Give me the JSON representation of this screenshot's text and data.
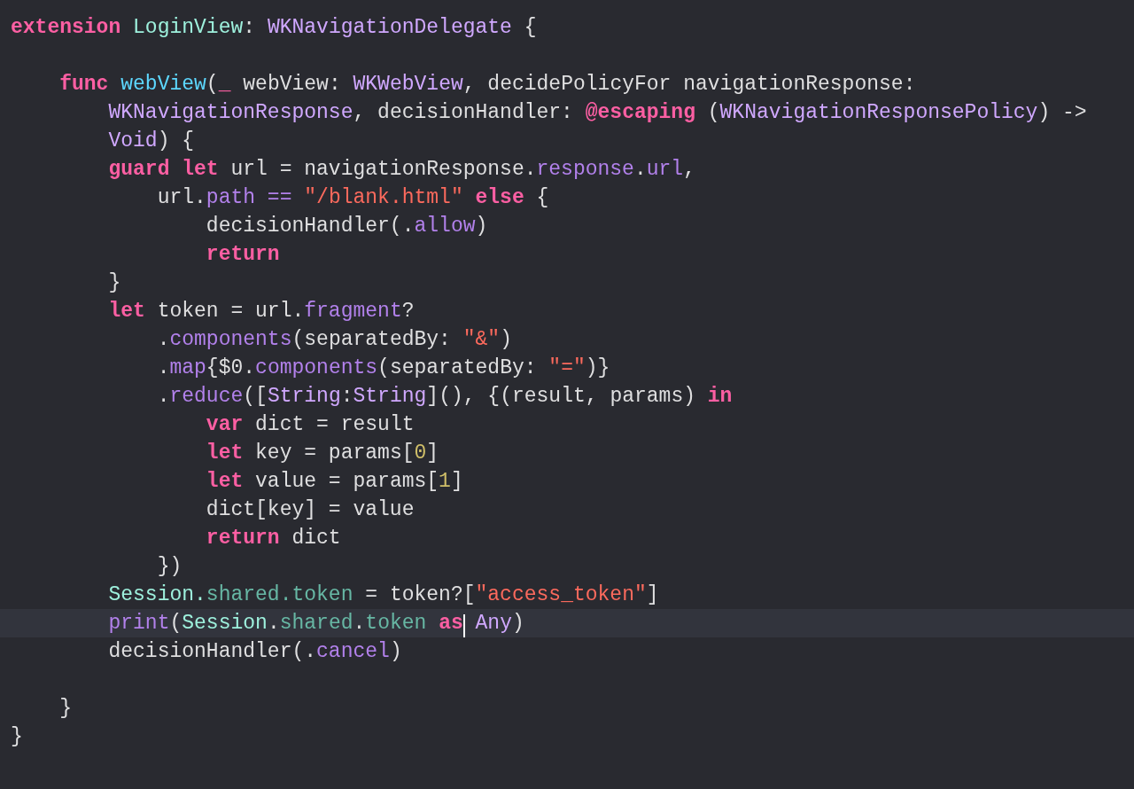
{
  "editor": {
    "lines": [
      {
        "current": false,
        "tokens": [
          {
            "text": "extension ",
            "kind": "kw"
          },
          {
            "text": "LoginView",
            "kind": "ptype"
          },
          {
            "text": ": "
          },
          {
            "text": "WKNavigationDelegate",
            "kind": "type"
          },
          {
            "text": " {"
          }
        ]
      },
      {
        "current": false
      },
      {
        "current": false,
        "tokens": [
          {
            "text": "    func ",
            "kind": "kw"
          },
          {
            "text": "webView",
            "kind": "decl"
          },
          {
            "text": "("
          },
          {
            "text": "_",
            "kind": "kw"
          },
          {
            "text": " webView: "
          },
          {
            "text": "WKWebView",
            "kind": "type"
          },
          {
            "text": ", decidePolicyFor navigationResponse:"
          }
        ]
      },
      {
        "current": false,
        "tokens": [
          {
            "text": "        WKNavigationResponse",
            "kind": "type"
          },
          {
            "text": ", decisionHandler: "
          },
          {
            "text": "@escaping",
            "kind": "kw"
          },
          {
            "text": " ("
          },
          {
            "text": "WKNavigationResponsePolicy",
            "kind": "type"
          },
          {
            "text": ") ->"
          }
        ]
      },
      {
        "current": false,
        "tokens": [
          {
            "text": "        Void",
            "kind": "type"
          },
          {
            "text": ") {"
          }
        ]
      },
      {
        "current": false,
        "tokens": [
          {
            "text": "        guard let",
            "kind": "kw"
          },
          {
            "text": " url = navigationResponse."
          },
          {
            "text": "response",
            "kind": "member"
          },
          {
            "text": "."
          },
          {
            "text": "url",
            "kind": "member"
          },
          {
            "text": ","
          }
        ]
      },
      {
        "current": false,
        "tokens": [
          {
            "text": "            url."
          },
          {
            "text": "path ==",
            "kind": "member"
          },
          {
            "text": " \"/blank.html\"",
            "kind": "str"
          },
          {
            "text": " else",
            "kind": "kw"
          },
          {
            "text": " {"
          }
        ]
      },
      {
        "current": false,
        "tokens": [
          {
            "text": "                decisionHandler(."
          },
          {
            "text": "allow",
            "kind": "member"
          },
          {
            "text": ")"
          }
        ]
      },
      {
        "current": false,
        "tokens": [
          {
            "text": "                return",
            "kind": "kw"
          }
        ]
      },
      {
        "current": false,
        "tokens": [
          {
            "text": "        }"
          }
        ]
      },
      {
        "current": false,
        "tokens": [
          {
            "text": "        let",
            "kind": "kw"
          },
          {
            "text": " token = url."
          },
          {
            "text": "fragment",
            "kind": "member"
          },
          {
            "text": "?"
          }
        ]
      },
      {
        "current": false,
        "tokens": [
          {
            "text": "            ."
          },
          {
            "text": "components",
            "kind": "member"
          },
          {
            "text": "(separatedBy: "
          },
          {
            "text": "\"&\"",
            "kind": "str"
          },
          {
            "text": ")"
          }
        ]
      },
      {
        "current": false,
        "tokens": [
          {
            "text": "            ."
          },
          {
            "text": "map",
            "kind": "member"
          },
          {
            "text": "{$0."
          },
          {
            "text": "components",
            "kind": "member"
          },
          {
            "text": "(separatedBy: "
          },
          {
            "text": "\"=\"",
            "kind": "str"
          },
          {
            "text": ")}"
          }
        ]
      },
      {
        "current": false,
        "tokens": [
          {
            "text": "            ."
          },
          {
            "text": "reduce",
            "kind": "member"
          },
          {
            "text": "(["
          },
          {
            "text": "String",
            "kind": "type"
          },
          {
            "text": ":"
          },
          {
            "text": "String",
            "kind": "type"
          },
          {
            "text": "](), {(result, params) "
          },
          {
            "text": "in",
            "kind": "kw"
          }
        ]
      },
      {
        "current": false,
        "tokens": [
          {
            "text": "                var",
            "kind": "kw"
          },
          {
            "text": " dict = result"
          }
        ]
      },
      {
        "current": false,
        "tokens": [
          {
            "text": "                let",
            "kind": "kw"
          },
          {
            "text": " key = params["
          },
          {
            "text": "0",
            "kind": "num"
          },
          {
            "text": "]"
          }
        ]
      },
      {
        "current": false,
        "tokens": [
          {
            "text": "                let",
            "kind": "kw"
          },
          {
            "text": " value = params["
          },
          {
            "text": "1",
            "kind": "num"
          },
          {
            "text": "]"
          }
        ]
      },
      {
        "current": false,
        "tokens": [
          {
            "text": "                dict[key] = value"
          }
        ]
      },
      {
        "current": false,
        "tokens": [
          {
            "text": "                return",
            "kind": "kw"
          },
          {
            "text": " dict"
          }
        ]
      },
      {
        "current": false,
        "tokens": [
          {
            "text": "            })"
          }
        ]
      },
      {
        "current": false,
        "tokens": [
          {
            "text": "        Session.",
            "kind": "ptype"
          },
          {
            "text": "shared.token",
            "kind": "pmember"
          },
          {
            "text": " = token?["
          },
          {
            "text": "\"access_token\"",
            "kind": "str"
          },
          {
            "text": "]"
          }
        ]
      },
      {
        "current": true,
        "tokens": [
          {
            "text": "        print",
            "kind": "member"
          },
          {
            "text": "("
          },
          {
            "text": "Session",
            "kind": "ptype"
          },
          {
            "text": "."
          },
          {
            "text": "shared",
            "kind": "pmember"
          },
          {
            "text": "."
          },
          {
            "text": "token ",
            "kind": "pmember"
          },
          {
            "text": "as",
            "kind": "kw",
            "caret": true
          },
          {
            "text": " Any",
            "kind": "type"
          },
          {
            "text": ")"
          }
        ]
      },
      {
        "current": false,
        "tokens": [
          {
            "text": "        decisionHandler(."
          },
          {
            "text": "cancel",
            "kind": "member"
          },
          {
            "text": ")"
          }
        ]
      },
      {
        "current": false
      },
      {
        "current": false,
        "tokens": [
          {
            "text": "    }"
          }
        ]
      },
      {
        "current": false,
        "tokens": [
          {
            "text": "}"
          }
        ]
      }
    ]
  }
}
